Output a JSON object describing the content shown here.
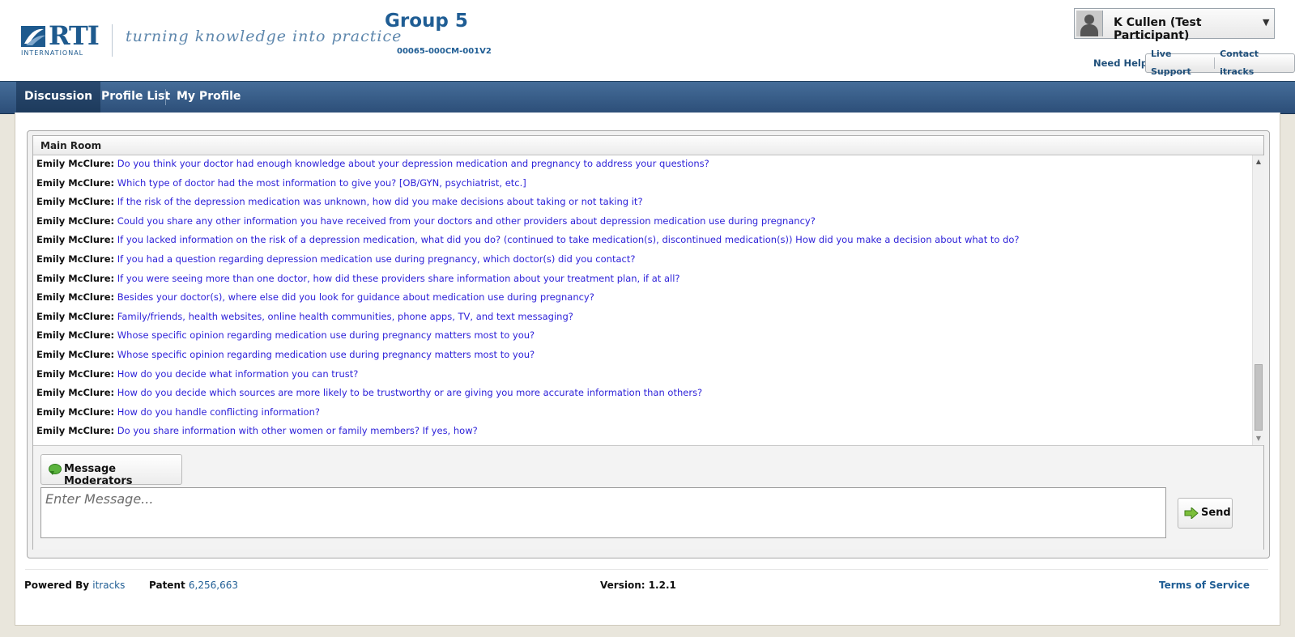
{
  "brand": {
    "logo_text": "RTI",
    "logo_sub": "INTERNATIONAL",
    "tagline": "turning knowledge into practice"
  },
  "header": {
    "group_title": "Group 5",
    "project_code": "00065-000CM-001V2"
  },
  "user": {
    "name": "K Cullen (Test Participant)"
  },
  "help": {
    "need_help": "Need Help?",
    "live_support": "Live Support",
    "contact": "Contact itracks"
  },
  "nav": {
    "items": [
      {
        "label": "Discussion"
      },
      {
        "label": "Profile List"
      },
      {
        "label": "My Profile"
      }
    ]
  },
  "room": {
    "name": "Main Room",
    "messages": [
      {
        "author": "Emily McClure:",
        "text": "Do you think your doctor had enough knowledge about your depression medication and pregnancy to address your questions?"
      },
      {
        "author": "Emily McClure:",
        "text": "Which type of doctor had the most information to give you? [OB/GYN, psychiatrist, etc.]"
      },
      {
        "author": "Emily McClure:",
        "text": "If the risk of the depression medication was unknown, how did you make decisions about taking or not taking it?"
      },
      {
        "author": "Emily McClure:",
        "text": "Could you share any other information you have received from your doctors and other providers about depression medication use during pregnancy?"
      },
      {
        "author": "Emily McClure:",
        "text": "If you lacked information on the risk of a depression medication, what did you do? (continued to take medication(s), discontinued medication(s)) How did you make a decision about what to do?"
      },
      {
        "author": "Emily McClure:",
        "text": "If you had a question regarding depression medication use during pregnancy, which doctor(s) did you contact?"
      },
      {
        "author": "Emily McClure:",
        "text": "If you were seeing more than one doctor, how did these providers share information about your treatment plan, if at all?"
      },
      {
        "author": "Emily McClure:",
        "text": "Besides your doctor(s), where else did you look for guidance about medication use during pregnancy?"
      },
      {
        "author": "Emily McClure:",
        "text": "Family/friends, health websites, online health communities, phone apps, TV, and text messaging?"
      },
      {
        "author": "Emily McClure:",
        "text": "Whose specific opinion regarding medication use during pregnancy matters most to you?"
      },
      {
        "author": "Emily McClure:",
        "text": "Whose specific opinion regarding medication use during pregnancy matters most to you?"
      },
      {
        "author": "Emily McClure:",
        "text": "How do you decide what information you can trust?"
      },
      {
        "author": "Emily McClure:",
        "text": "How do you decide which sources are more likely to be trustworthy or are giving you more accurate information than others?"
      },
      {
        "author": "Emily McClure:",
        "text": "How do you handle conflicting information?"
      },
      {
        "author": "Emily McClure:",
        "text": "Do you share information with other women or family members? If yes, how?"
      }
    ]
  },
  "compose": {
    "message_moderators": "Message Moderators",
    "placeholder": "Enter Message...",
    "value": "",
    "send": "Send"
  },
  "footer": {
    "powered_by": "Powered By",
    "powered_link": "itracks",
    "patent": "Patent",
    "patent_number": "6,256,663",
    "version": "Version: 1.2.1",
    "terms": "Terms of Service"
  },
  "colors": {
    "brand_blue": "#1f5d94",
    "nav_bar": "#35577f",
    "message_text": "#2b1fd8",
    "chat_icon_green": "#5bb33d"
  },
  "icons": {
    "user_avatar": "person-silhouette-icon",
    "dropdown": "chevron-down-icon",
    "message_moderators": "chat-bubble-icon",
    "send": "arrow-right-icon"
  }
}
